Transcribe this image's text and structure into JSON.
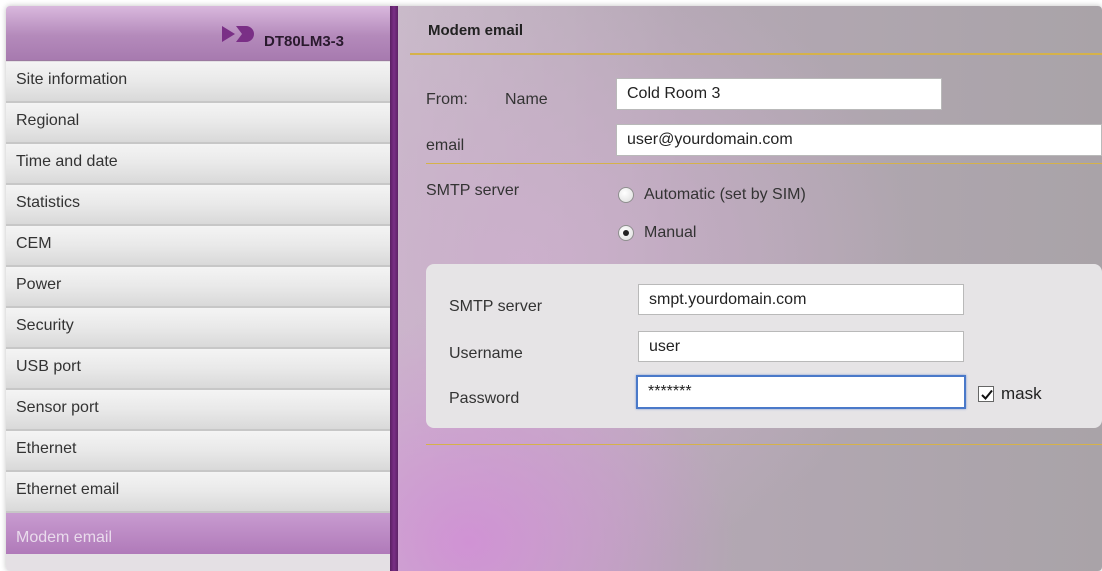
{
  "sidebar": {
    "device_name": "DT80LM3-3",
    "logo_icon": "dt-logo-icon",
    "items": [
      {
        "label": "Site information"
      },
      {
        "label": "Regional"
      },
      {
        "label": "Time and date"
      },
      {
        "label": "Statistics"
      },
      {
        "label": "CEM"
      },
      {
        "label": "Power"
      },
      {
        "label": "Security"
      },
      {
        "label": "USB port"
      },
      {
        "label": "Sensor port"
      },
      {
        "label": "Ethernet"
      },
      {
        "label": "Ethernet email"
      },
      {
        "label": "Modem email",
        "active": true
      }
    ]
  },
  "main": {
    "title": "Modem email",
    "from_label": "From:",
    "name_label": "Name",
    "name_value": "Cold Room 3",
    "email_label": "email",
    "email_value": "user@yourdomain.com",
    "smtp_server_label": "SMTP server",
    "smtp_mode": {
      "automatic_label": "Automatic (set by SIM)",
      "manual_label": "Manual",
      "selected": "Manual"
    },
    "panel": {
      "server_label": "SMTP server",
      "server_value": "smpt.yourdomain.com",
      "username_label": "Username",
      "username_value": "user",
      "password_label": "Password",
      "password_value": "*******",
      "mask_label": "mask",
      "mask_checked": true
    }
  },
  "colors": {
    "accent_purple": "#6a2575",
    "gold_rule": "#d5b24a",
    "focus_blue": "#4a79c9"
  }
}
